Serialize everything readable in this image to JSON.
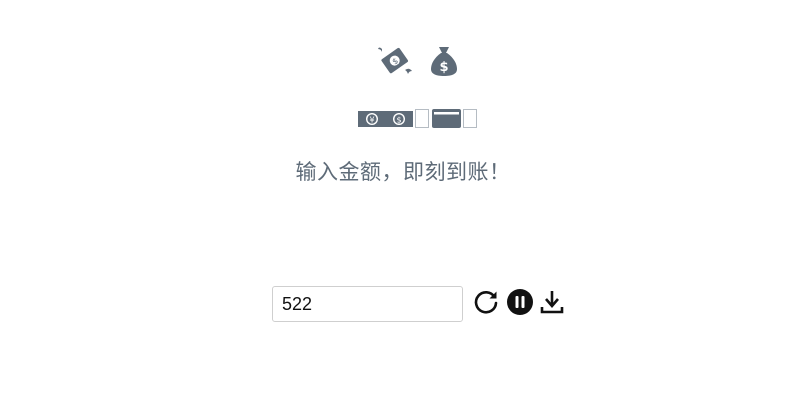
{
  "header": {
    "icons": [
      "flying-money-icon",
      "money-bag-icon"
    ]
  },
  "money_row": {
    "icons": [
      "yuan-banknote-icon",
      "dollar-banknote-icon",
      "blank-card-icon",
      "credit-card-icon",
      "blank-card-icon"
    ],
    "yuan_symbol": "¥",
    "dollar_symbol": "$"
  },
  "headline": {
    "text": "输入金额，即刻到账！"
  },
  "controls": {
    "amount_value": "522",
    "buttons": [
      "refresh-icon",
      "pause-icon",
      "download-icon"
    ]
  },
  "colors": {
    "icon_slate": "#5e6b78",
    "control_black": "#111111",
    "input_border": "#cfcfcf"
  }
}
